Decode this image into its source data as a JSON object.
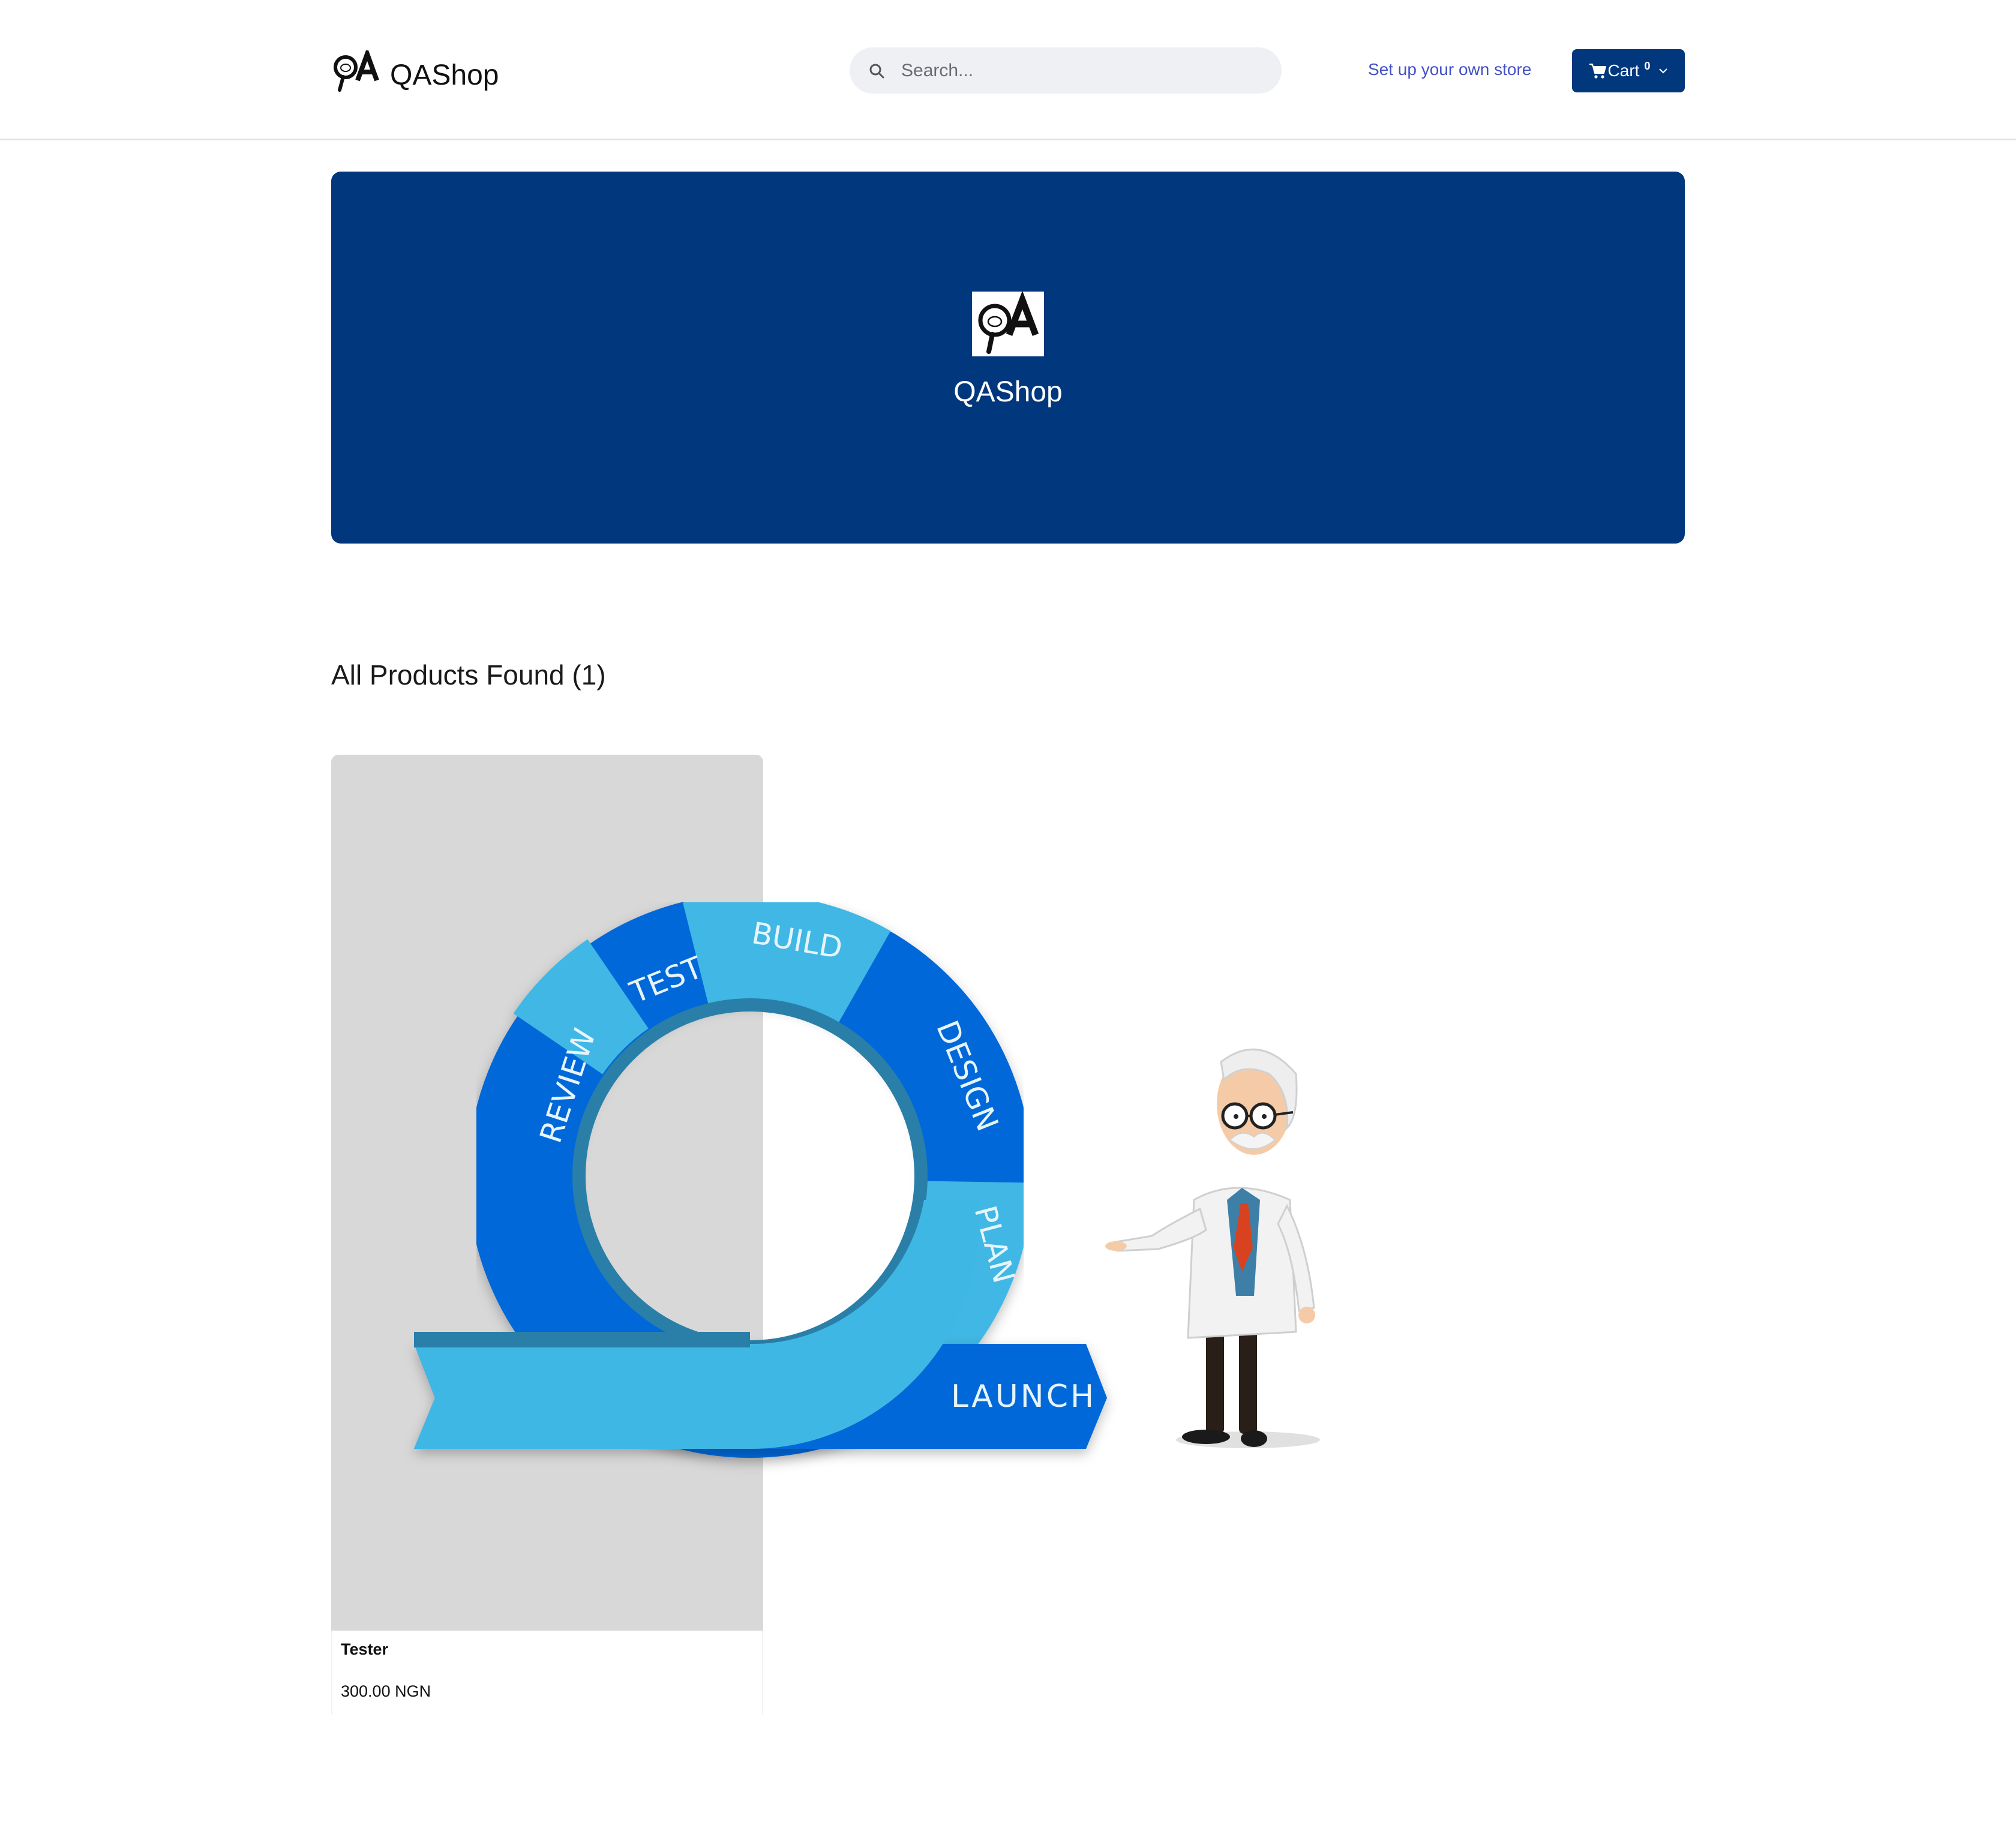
{
  "header": {
    "brand_name": "QAShop",
    "logo_letters": "QA",
    "search_placeholder": "Search...",
    "setup_link": "Set up your own store",
    "cart_label": "Cart",
    "cart_count": "0"
  },
  "hero": {
    "store_name": "QAShop",
    "logo_letters": "QA",
    "background_color": "#01377d"
  },
  "products": {
    "heading": "All Products Found (1)",
    "items": [
      {
        "name": "Tester",
        "price": "300.00 NGN",
        "image": {
          "cycle_labels": [
            "BUILD",
            "DESIGN",
            "PLAN",
            "REVIEW",
            "TEST",
            "LAUNCH"
          ]
        }
      }
    ]
  },
  "icons": {
    "search": "search-icon",
    "cart": "cart-icon",
    "dropdown": "chevron-down-icon"
  },
  "colors": {
    "accent": "#01377d",
    "link": "#4450c8",
    "cycle_light": "#3fb7e4",
    "cycle_dark": "#0368d9"
  }
}
